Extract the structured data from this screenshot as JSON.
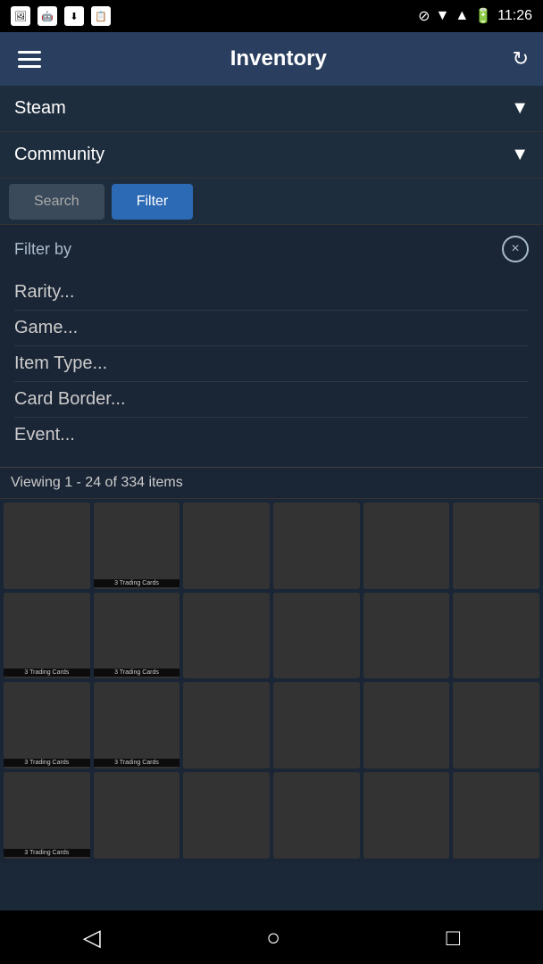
{
  "status_bar": {
    "time": "11:26"
  },
  "header": {
    "title": "Inventory",
    "hamburger_label": "menu",
    "refresh_label": "refresh"
  },
  "platform_dropdown": {
    "label": "Steam",
    "arrow": "▼"
  },
  "community_dropdown": {
    "label": "Community",
    "arrow": "▼"
  },
  "tabs": {
    "search_label": "Search",
    "filter_label": "Filter"
  },
  "filter_panel": {
    "title": "Filter by",
    "close_label": "×",
    "options": [
      "Rarity...",
      "Game...",
      "Item Type...",
      "Card Border...",
      "Event..."
    ]
  },
  "item_count": "Viewing 1 - 24 of 334 items",
  "grid": {
    "items": [
      {
        "id": 1,
        "color": "color-rainbow",
        "badge": ""
      },
      {
        "id": 2,
        "color": "color-l4d",
        "badge": "3 Trading Cards"
      },
      {
        "id": 3,
        "color": "color-contag",
        "badge": ""
      },
      {
        "id": 4,
        "color": "color-cook",
        "badge": ""
      },
      {
        "id": 5,
        "color": "color-enigma",
        "badge": ""
      },
      {
        "id": 6,
        "color": "color-euro",
        "badge": ""
      },
      {
        "id": 7,
        "color": "color-ftl",
        "badge": "3 Trading Cards"
      },
      {
        "id": 8,
        "color": "color-item",
        "badge": "3 Trading Cards"
      },
      {
        "id": 9,
        "color": "color-cook",
        "badge": ""
      },
      {
        "id": 10,
        "color": "color-cook",
        "badge": ""
      },
      {
        "id": 11,
        "color": "color-enigma",
        "badge": ""
      },
      {
        "id": 12,
        "color": "color-faerie",
        "badge": ""
      },
      {
        "id": 13,
        "color": "color-faerie",
        "badge": "3 Trading Cards"
      },
      {
        "id": 14,
        "color": "color-octopus",
        "badge": "3 Trading Cards"
      },
      {
        "id": 15,
        "color": "color-cook",
        "badge": ""
      },
      {
        "id": 16,
        "color": "color-cook",
        "badge": ""
      },
      {
        "id": 17,
        "color": "color-euro",
        "badge": ""
      },
      {
        "id": 18,
        "color": "color-faerie",
        "badge": ""
      },
      {
        "id": 19,
        "color": "color-dark",
        "badge": "3 Trading Cards"
      },
      {
        "id": 20,
        "color": "color-red",
        "badge": ""
      },
      {
        "id": 21,
        "color": "color-banana",
        "badge": ""
      },
      {
        "id": 22,
        "color": "color-dota",
        "badge": ""
      },
      {
        "id": 23,
        "color": "color-euro",
        "badge": ""
      },
      {
        "id": 24,
        "color": "color-rainbow",
        "badge": ""
      }
    ]
  },
  "bottom_nav": {
    "back_label": "◁",
    "home_label": "○",
    "recent_label": "□"
  }
}
